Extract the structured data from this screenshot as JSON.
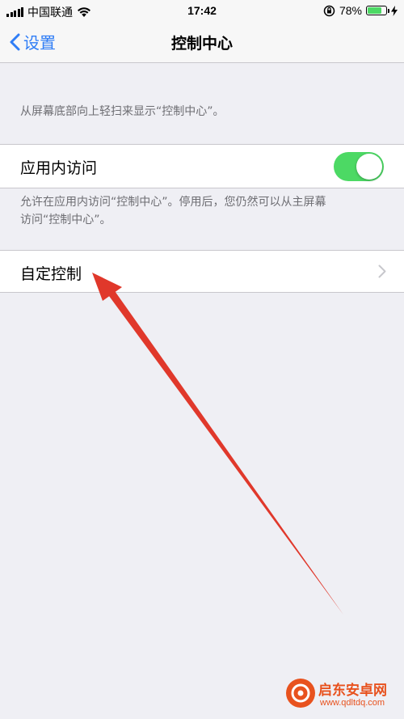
{
  "status_bar": {
    "carrier": "中国联通",
    "time": "17:42",
    "battery_percent": "78%",
    "battery_level": 0.78,
    "icons": [
      "signal-icon",
      "wifi-icon",
      "orientation-lock-icon",
      "battery-icon",
      "charging-icon"
    ]
  },
  "nav": {
    "back_label": "设置",
    "title": "控制中心"
  },
  "main": {
    "intro_hint": "从屏幕底部向上轻扫来显示“控制中心”。",
    "access_within_apps": {
      "label": "应用内访问",
      "enabled": true
    },
    "access_hint_line1": "允许在应用内访问“控制中心”。停用后，您仍然可以从主屏幕",
    "access_hint_line2": "访问“控制中心”。",
    "customize": {
      "label": "自定控制"
    }
  },
  "watermark": {
    "name": "启东安卓网",
    "url": "www.qdltdq.com"
  },
  "colors": {
    "accent": "#2f7df6",
    "toggle_on": "#4cd964",
    "background": "#efeff4",
    "annotation_arrow": "#e0382b",
    "watermark": "#e8521e"
  }
}
